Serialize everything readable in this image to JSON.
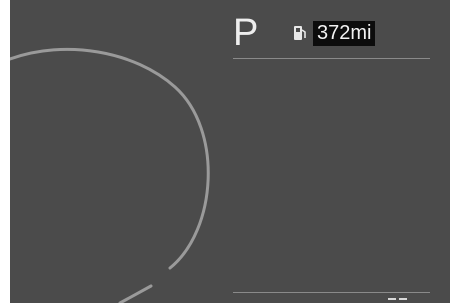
{
  "display": {
    "gear": "P",
    "range": "372mi",
    "fuel_icon": "fuel-pump-icon"
  },
  "colors": {
    "background": "#4b4b4b",
    "text": "#eeeeee",
    "range_box": "#0c0c0c",
    "gauge_arc": "#9a9a9a",
    "divider": "#8a8a8a"
  }
}
